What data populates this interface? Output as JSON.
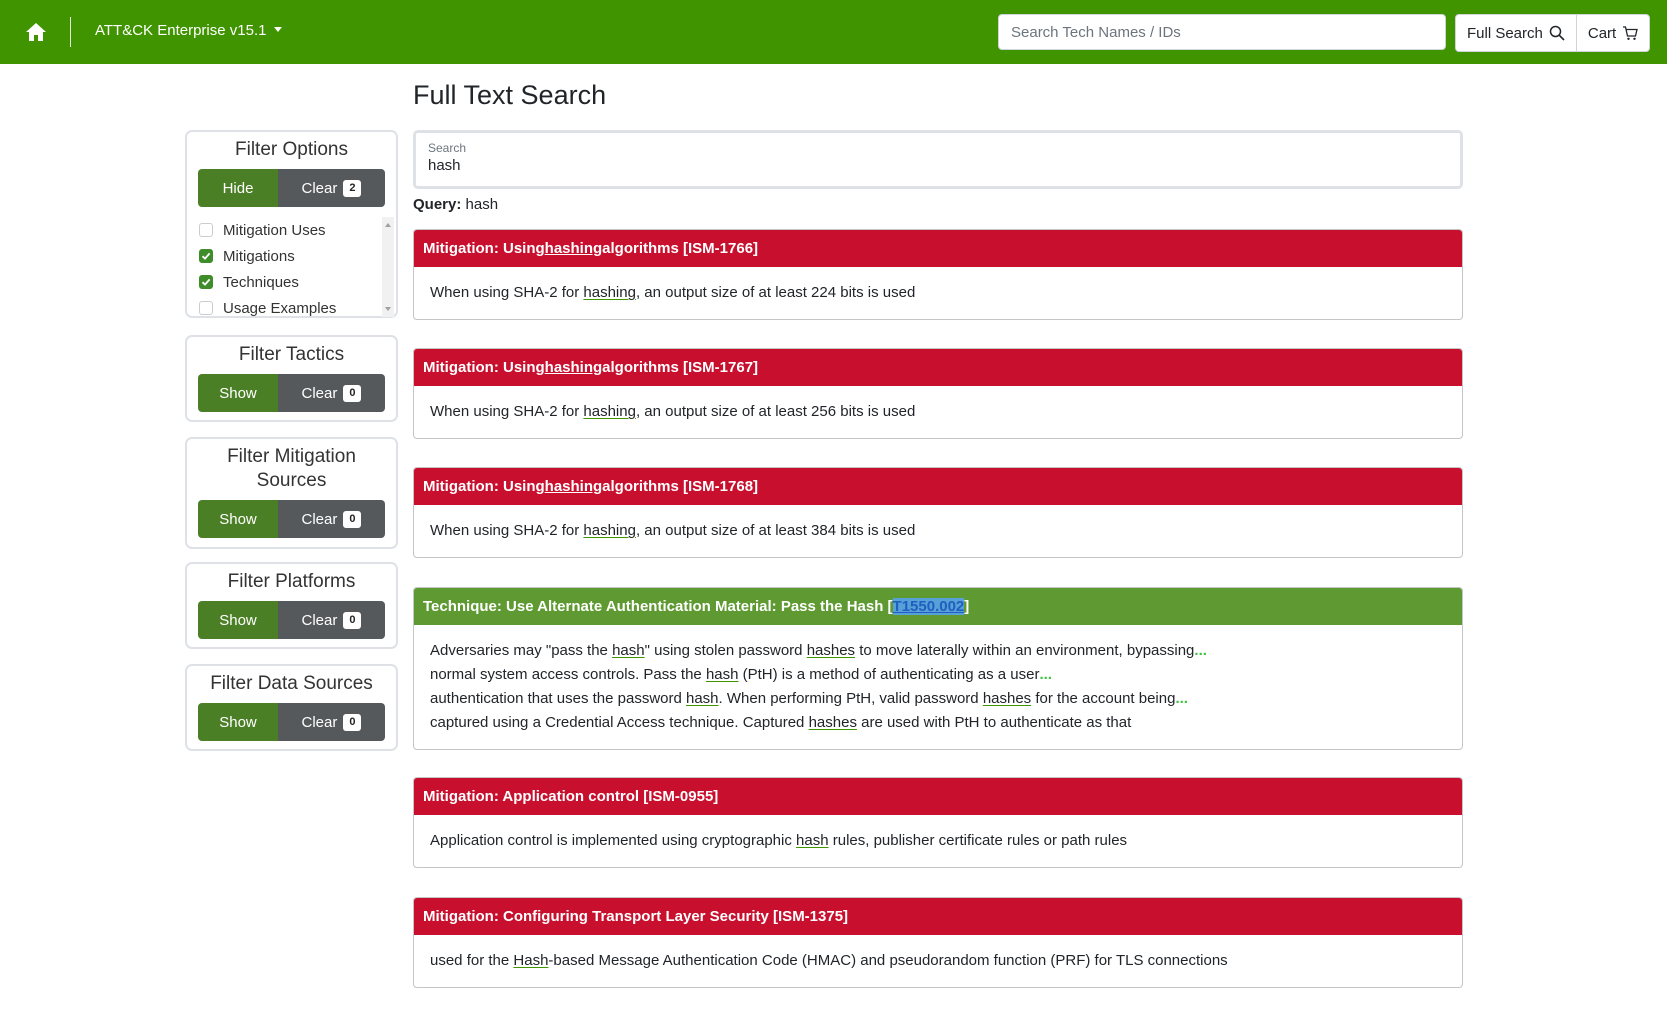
{
  "navbar": {
    "brand": "ATT&CK Enterprise v15.1",
    "search_placeholder": "Search Tech Names / IDs",
    "full_search_label": "Full Search",
    "cart_label": "Cart",
    "icons": [
      "home-icon",
      "caret-down-icon",
      "search-icon",
      "cart-icon"
    ],
    "color": "#3f9400"
  },
  "page_title": "Full Text Search",
  "sidebar": {
    "filter_options": {
      "title": "Filter Options",
      "toggle_label": "Hide",
      "clear_label": "Clear",
      "count": "2",
      "options": [
        {
          "label": "Mitigation Uses",
          "checked": false
        },
        {
          "label": "Mitigations",
          "checked": true
        },
        {
          "label": "Techniques",
          "checked": true
        },
        {
          "label": "Usage Examples",
          "checked": false
        }
      ]
    },
    "filter_tactics": {
      "title": "Filter Tactics",
      "toggle_label": "Show",
      "clear_label": "Clear",
      "count": "0"
    },
    "filter_mitigation_sources": {
      "title": "Filter Mitigation Sources",
      "toggle_label": "Show",
      "clear_label": "Clear",
      "count": "0"
    },
    "filter_platforms": {
      "title": "Filter Platforms",
      "toggle_label": "Show",
      "clear_label": "Clear",
      "count": "0"
    },
    "filter_data_sources": {
      "title": "Filter Data Sources",
      "toggle_label": "Show",
      "clear_label": "Clear",
      "count": "0"
    }
  },
  "search": {
    "label": "Search",
    "value": "hash"
  },
  "query": {
    "label": "Query:",
    "value": "hash"
  },
  "results": [
    {
      "kind": "mitigation",
      "prefix": "Mitigation: Using ",
      "keyword": "hashing",
      "suffix": " algorithms [ISM-1766]",
      "lines": [
        {
          "parts": [
            {
              "t": "When using SHA-2 for "
            },
            {
              "t": "hashing",
              "hl": true
            },
            {
              "t": ", an output size of at least 224 bits is used"
            }
          ]
        }
      ]
    },
    {
      "kind": "mitigation",
      "prefix": "Mitigation: Using ",
      "keyword": "hashing",
      "suffix": " algorithms [ISM-1767]",
      "lines": [
        {
          "parts": [
            {
              "t": "When using SHA-2 for "
            },
            {
              "t": "hashing",
              "hl": true
            },
            {
              "t": ", an output size of at least 256 bits is used"
            }
          ]
        }
      ]
    },
    {
      "kind": "mitigation",
      "prefix": "Mitigation: Using ",
      "keyword": "hashing",
      "suffix": " algorithms [ISM-1768]",
      "lines": [
        {
          "parts": [
            {
              "t": "When using SHA-2 for "
            },
            {
              "t": "hashing",
              "hl": true
            },
            {
              "t": ", an output size of at least 384 bits is used"
            }
          ]
        }
      ]
    },
    {
      "kind": "technique",
      "prefix": "Technique: Use Alternate Authentication Material: Pass the Hash [",
      "id": "T1550.002",
      "suffix": "]",
      "lines": [
        {
          "parts": [
            {
              "t": "Adversaries may \"pass the "
            },
            {
              "t": "hash",
              "hl": true
            },
            {
              "t": "\" using stolen password "
            },
            {
              "t": "hashes",
              "hl": true
            },
            {
              "t": " to move laterally within an environment, bypassing"
            },
            {
              "t": "...",
              "ell": true
            }
          ]
        },
        {
          "parts": [
            {
              "t": "normal system access controls. Pass the "
            },
            {
              "t": "hash",
              "hl": true
            },
            {
              "t": " (PtH) is a method of authenticating as a user"
            },
            {
              "t": "...",
              "ell": true
            }
          ]
        },
        {
          "parts": [
            {
              "t": "authentication that uses the password "
            },
            {
              "t": "hash",
              "hl": true
            },
            {
              "t": ". When performing PtH, valid password "
            },
            {
              "t": "hashes",
              "hl": true
            },
            {
              "t": " for the account being"
            },
            {
              "t": "...",
              "ell": true
            }
          ]
        },
        {
          "parts": [
            {
              "t": "captured using a Credential Access technique. Captured "
            },
            {
              "t": "hashes",
              "hl": true
            },
            {
              "t": " are used with PtH to authenticate as that"
            }
          ]
        }
      ]
    },
    {
      "kind": "mitigation",
      "prefix": "Mitigation: Application control [ISM-0955]",
      "lines": [
        {
          "parts": [
            {
              "t": "Application control is implemented using cryptographic "
            },
            {
              "t": "hash",
              "hl": true
            },
            {
              "t": " rules, publisher certificate rules or path rules"
            }
          ]
        }
      ]
    },
    {
      "kind": "mitigation",
      "prefix": "Mitigation: Configuring Transport Layer Security [ISM-1375]",
      "lines": [
        {
          "parts": [
            {
              "t": "used for the "
            },
            {
              "t": "Hash",
              "hl": true
            },
            {
              "t": "-based Message Authentication Code (HMAC) and pseudorandom function (PRF) for TLS connections"
            }
          ]
        }
      ]
    }
  ],
  "colors": {
    "mitigation_header": "#c8102e",
    "technique_header": "#5e9a31",
    "filter_button": "#4b7f25",
    "clear_button": "#55595c"
  }
}
